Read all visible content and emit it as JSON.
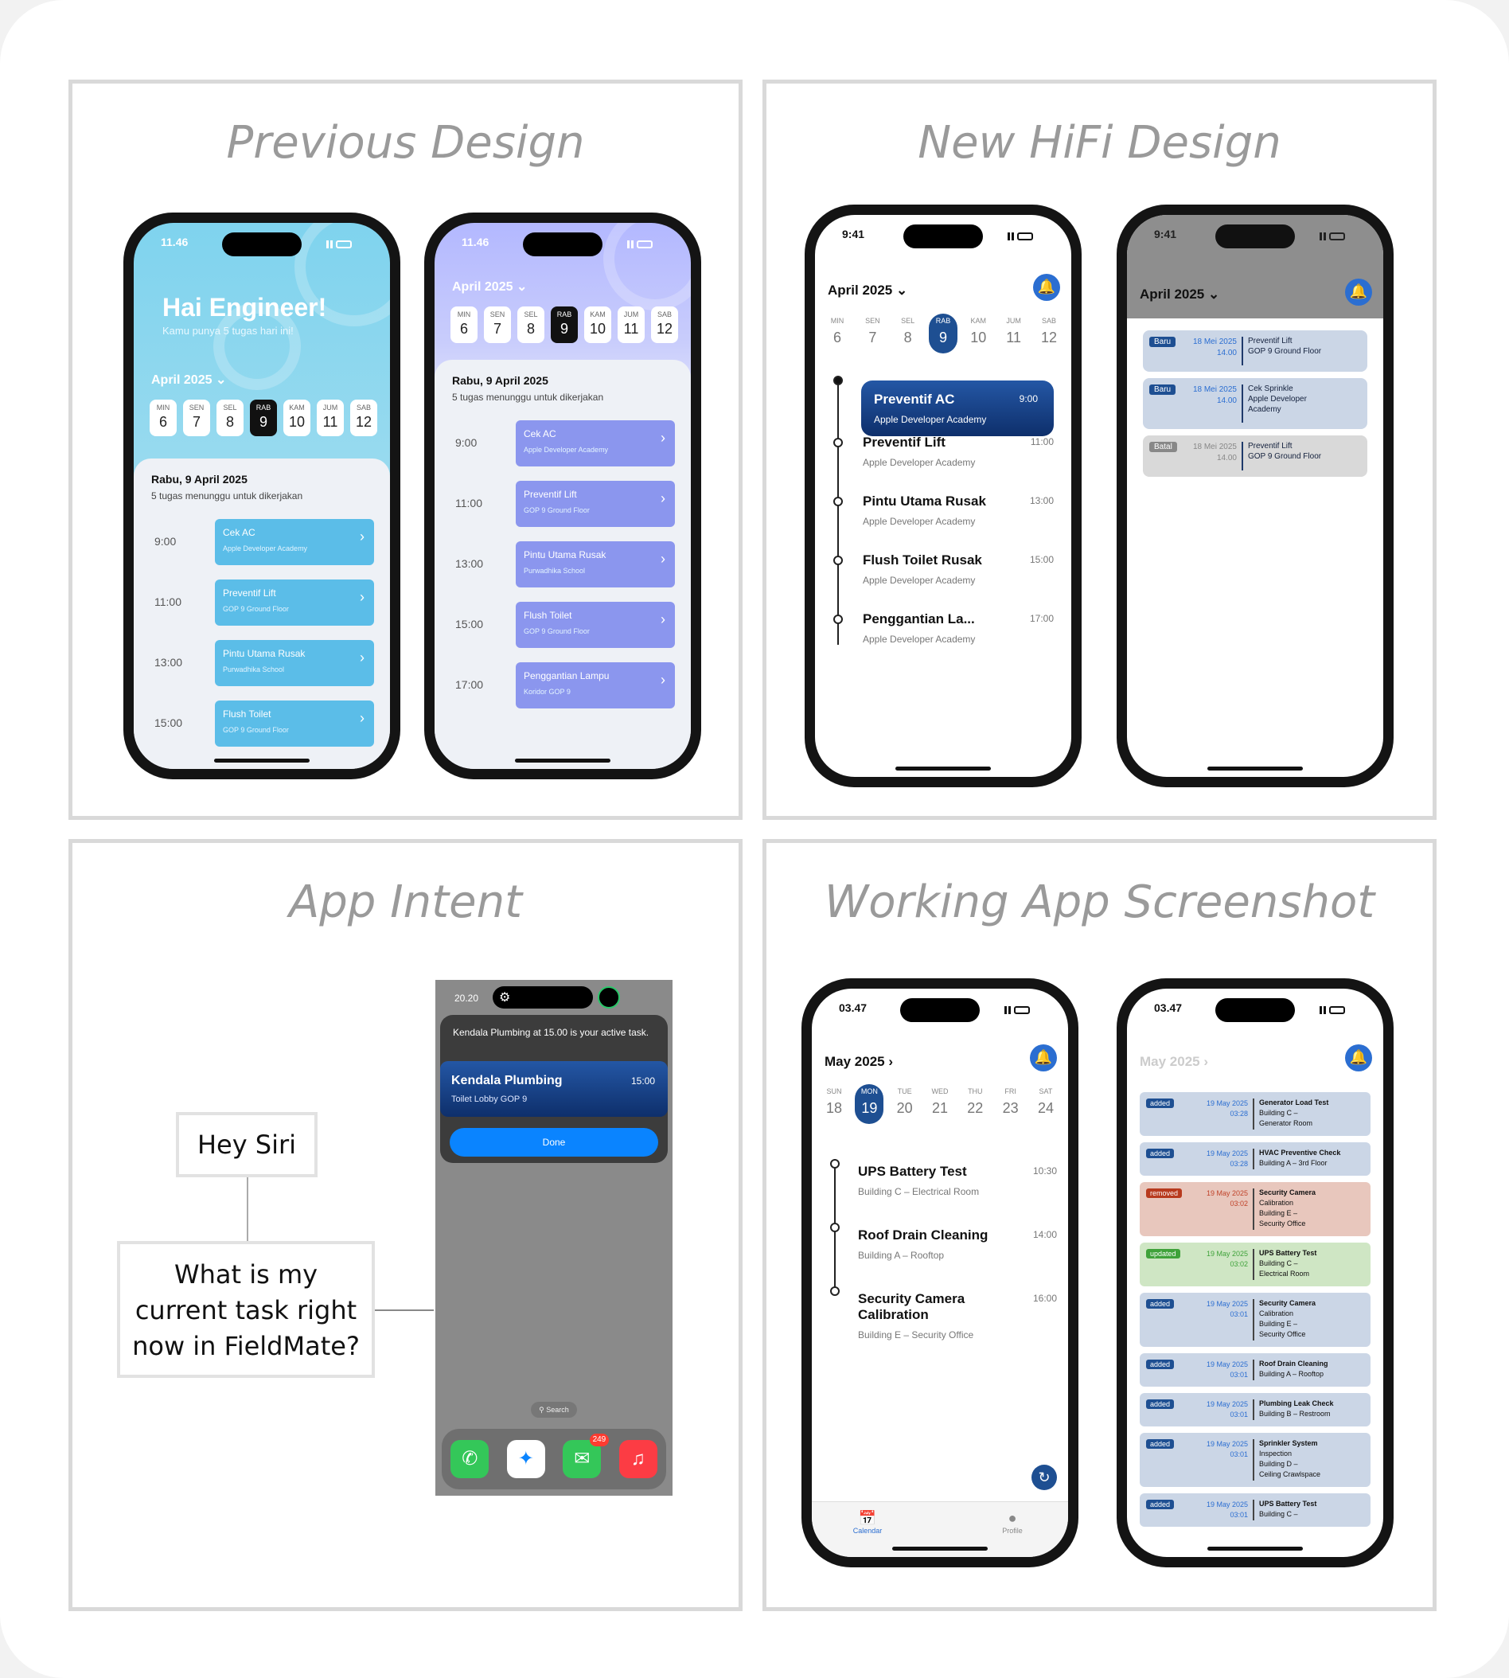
{
  "titles": {
    "previous": "Previous Design",
    "hifi": "New HiFi Design",
    "intent": "App Intent",
    "working": "Working App Screenshot"
  },
  "colors": {
    "cyan": "#5bbde8",
    "violet": "#8b96ee",
    "navy": "#1e4f92",
    "siri_blue": "#0a84ff"
  },
  "previous": {
    "time": "11.46",
    "greeting": "Hai Engineer!",
    "subtitle": "Kamu punya 5 tugas hari ini!",
    "month": "April 2025",
    "days": [
      {
        "d": "MIN",
        "n": "6"
      },
      {
        "d": "SEN",
        "n": "7"
      },
      {
        "d": "SEL",
        "n": "8"
      },
      {
        "d": "RAB",
        "n": "9"
      },
      {
        "d": "KAM",
        "n": "10"
      },
      {
        "d": "JUM",
        "n": "11"
      },
      {
        "d": "SAB",
        "n": "12"
      }
    ],
    "date": "Rabu, 9 April 2025",
    "count": "5 tugas menunggu untuk dikerjakan",
    "tasks1": [
      {
        "t": "9:00",
        "n": "Cek AC",
        "l": "Apple Developer Academy"
      },
      {
        "t": "11:00",
        "n": "Preventif Lift",
        "l": "GOP 9 Ground Floor"
      },
      {
        "t": "13:00",
        "n": "Pintu Utama Rusak",
        "l": "Purwadhika School"
      },
      {
        "t": "15:00",
        "n": "Flush Toilet",
        "l": "GOP 9 Ground Floor"
      }
    ],
    "tasks2": [
      {
        "t": "9:00",
        "n": "Cek AC",
        "l": "Apple Developer Academy"
      },
      {
        "t": "11:00",
        "n": "Preventif Lift",
        "l": "GOP 9 Ground Floor"
      },
      {
        "t": "13:00",
        "n": "Pintu Utama Rusak",
        "l": "Purwadhika School"
      },
      {
        "t": "15:00",
        "n": "Flush Toilet",
        "l": "GOP 9 Ground Floor"
      },
      {
        "t": "17:00",
        "n": "Penggantian Lampu",
        "l": "Koridor GOP 9"
      }
    ]
  },
  "hifi": {
    "time": "9:41",
    "month": "April 2025",
    "days": [
      {
        "d": "MIN",
        "n": "6"
      },
      {
        "d": "SEN",
        "n": "7"
      },
      {
        "d": "SEL",
        "n": "8"
      },
      {
        "d": "RAB",
        "n": "9"
      },
      {
        "d": "KAM",
        "n": "10"
      },
      {
        "d": "JUM",
        "n": "11"
      },
      {
        "d": "SAB",
        "n": "12"
      }
    ],
    "tasks": [
      {
        "n": "Preventif AC",
        "l": "Apple Developer Academy",
        "t": "9:00"
      },
      {
        "n": "Preventif Lift",
        "l": "Apple Developer Academy",
        "t": "11:00"
      },
      {
        "n": "Pintu Utama Rusak",
        "l": "Apple Developer Academy",
        "t": "13:00"
      },
      {
        "n": "Flush Toilet Rusak",
        "l": "Apple Developer Academy",
        "t": "15:00"
      },
      {
        "n": "Penggantian La...",
        "l": "Apple Developer Academy",
        "t": "17:00"
      }
    ],
    "notifications": [
      {
        "tag": "Baru",
        "date": "18 Mei 2025",
        "time": "14.00",
        "t1": "Preventif Lift",
        "t2": "GOP 9 Ground Floor",
        "t3": ""
      },
      {
        "tag": "Baru",
        "date": "18 Mei 2025",
        "time": "14.00",
        "t1": "Cek Sprinkle",
        "t2": "Apple Developer",
        "t3": "Academy"
      },
      {
        "tag": "Batal",
        "date": "18 Mei 2025",
        "time": "14.00",
        "t1": "Preventif Lift",
        "t2": "GOP 9 Ground Floor",
        "t3": ""
      }
    ]
  },
  "intent": {
    "q1": "Hey Siri",
    "q2": "What is my current task right now in FieldMate?",
    "time": "20.20",
    "message": "Kendala Plumbing at 15.00 is your active task.",
    "task": "Kendala Plumbing",
    "task_time": "15:00",
    "task_loc": "Toilet Lobby GOP 9",
    "done": "Done",
    "search": "Search",
    "badge": "249"
  },
  "working": {
    "time": "03.47",
    "month": "May 2025",
    "days": [
      {
        "d": "SUN",
        "n": "18"
      },
      {
        "d": "MON",
        "n": "19"
      },
      {
        "d": "TUE",
        "n": "20"
      },
      {
        "d": "WED",
        "n": "21"
      },
      {
        "d": "THU",
        "n": "22"
      },
      {
        "d": "FRI",
        "n": "23"
      },
      {
        "d": "SAT",
        "n": "24"
      }
    ],
    "tasks": [
      {
        "n": "UPS Battery Test",
        "l": "Building C – Electrical Room",
        "t": "10:30"
      },
      {
        "n": "Roof Drain Cleaning",
        "l": "Building A – Rooftop",
        "t": "14:00"
      },
      {
        "n": "Security Camera Calibration",
        "l": "Building E – Security Office",
        "t": "16:00"
      }
    ],
    "tabs": {
      "calendar": "Calendar",
      "profile": "Profile"
    },
    "log": [
      {
        "tag": "added",
        "date": "19 May 2025",
        "time": "03:28",
        "t1": "Generator Load Test",
        "t2": "Building C –",
        "t3": "Generator Room",
        "t4": ""
      },
      {
        "tag": "added",
        "date": "19 May 2025",
        "time": "03:28",
        "t1": "HVAC Preventive Check",
        "t2": "Building A – 3rd Floor",
        "t3": "",
        "t4": ""
      },
      {
        "tag": "removed",
        "date": "19 May 2025",
        "time": "03:02",
        "t1": "Security Camera",
        "t2": "Calibration",
        "t3": "Building E –",
        "t4": "Security Office"
      },
      {
        "tag": "updated",
        "date": "19 May 2025",
        "time": "03:02",
        "t1": "UPS Battery Test",
        "t2": "Building C –",
        "t3": "Electrical Room",
        "t4": ""
      },
      {
        "tag": "added",
        "date": "19 May 2025",
        "time": "03:01",
        "t1": "Security Camera",
        "t2": "Calibration",
        "t3": "Building E –",
        "t4": "Security Office"
      },
      {
        "tag": "added",
        "date": "19 May 2025",
        "time": "03:01",
        "t1": "Roof Drain Cleaning",
        "t2": "Building A – Rooftop",
        "t3": "",
        "t4": ""
      },
      {
        "tag": "added",
        "date": "19 May 2025",
        "time": "03:01",
        "t1": "Plumbing Leak Check",
        "t2": "Building B – Restroom",
        "t3": "",
        "t4": ""
      },
      {
        "tag": "added",
        "date": "19 May 2025",
        "time": "03:01",
        "t1": "Sprinkler System",
        "t2": "Inspection",
        "t3": "Building D –",
        "t4": "Ceiling Crawlspace"
      },
      {
        "tag": "added",
        "date": "19 May 2025",
        "time": "03:01",
        "t1": "UPS Battery Test",
        "t2": "Building C –",
        "t3": "",
        "t4": ""
      }
    ]
  }
}
